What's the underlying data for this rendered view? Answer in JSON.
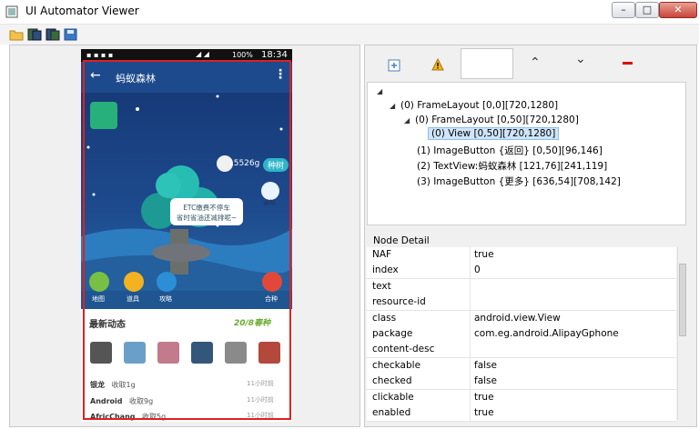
{
  "window": {
    "title": "UI Automator Viewer",
    "minimize": "–",
    "maximize": "□",
    "close": "✕"
  },
  "toolbar": {
    "icons": [
      "open-folder-icon",
      "device-screenshot-icon",
      "device-screenshot-compressed-icon",
      "save-icon"
    ]
  },
  "phone": {
    "status": {
      "battery": "100%",
      "time": "18:34"
    },
    "appbar": {
      "back": "←",
      "title": "蚂蚁森林",
      "more": "⋮"
    },
    "scene": {
      "points": "15526g",
      "plant_button": "种树",
      "notice": "通知",
      "bubble_line1": "ETC缴费不停车",
      "bubble_line2": "省时省油还减排呢~",
      "shortcuts": [
        {
          "label": "地图"
        },
        {
          "label": "道具"
        },
        {
          "label": "攻略"
        }
      ],
      "shop": "合种"
    },
    "feed": {
      "header": "最新动态",
      "event": "20/8春种",
      "entries": [
        {
          "name": "银龙",
          "action": "收取1g",
          "time": "11小时前"
        },
        {
          "name": "Android",
          "action": "收取9g",
          "time": "11小时前"
        },
        {
          "name": "AfricChang",
          "action": "收取5g",
          "time": "11小时前"
        }
      ]
    }
  },
  "tree": {
    "nodes": [
      {
        "label": "(0) FrameLayout [0,0][720,1280]"
      },
      {
        "label": "(0) FrameLayout [0,50][720,1280]"
      },
      {
        "label": "(0) View [0,50][720,1280]"
      },
      {
        "label": "(1) ImageButton {返回} [0,50][96,146]"
      },
      {
        "label": "(2) TextView:蚂蚁森林 [121,76][241,119]"
      },
      {
        "label": "(3) ImageButton {更多} [636,54][708,142]"
      }
    ]
  },
  "node_detail": {
    "title": "Node Detail",
    "rows": [
      {
        "key": "NAF",
        "value": "true"
      },
      {
        "key": "index",
        "value": "0"
      },
      {
        "key": "text",
        "value": ""
      },
      {
        "key": "resource-id",
        "value": ""
      },
      {
        "key": "class",
        "value": "android.view.View"
      },
      {
        "key": "package",
        "value": "com.eg.android.AlipayGphone"
      },
      {
        "key": "content-desc",
        "value": ""
      },
      {
        "key": "checkable",
        "value": "false"
      },
      {
        "key": "checked",
        "value": "false"
      },
      {
        "key": "clickable",
        "value": "true"
      },
      {
        "key": "enabled",
        "value": "true"
      }
    ]
  },
  "colors": {
    "selection": "#e02020",
    "app_bar": "#1d4a8c",
    "tree_selected": "#cfe4fa"
  }
}
